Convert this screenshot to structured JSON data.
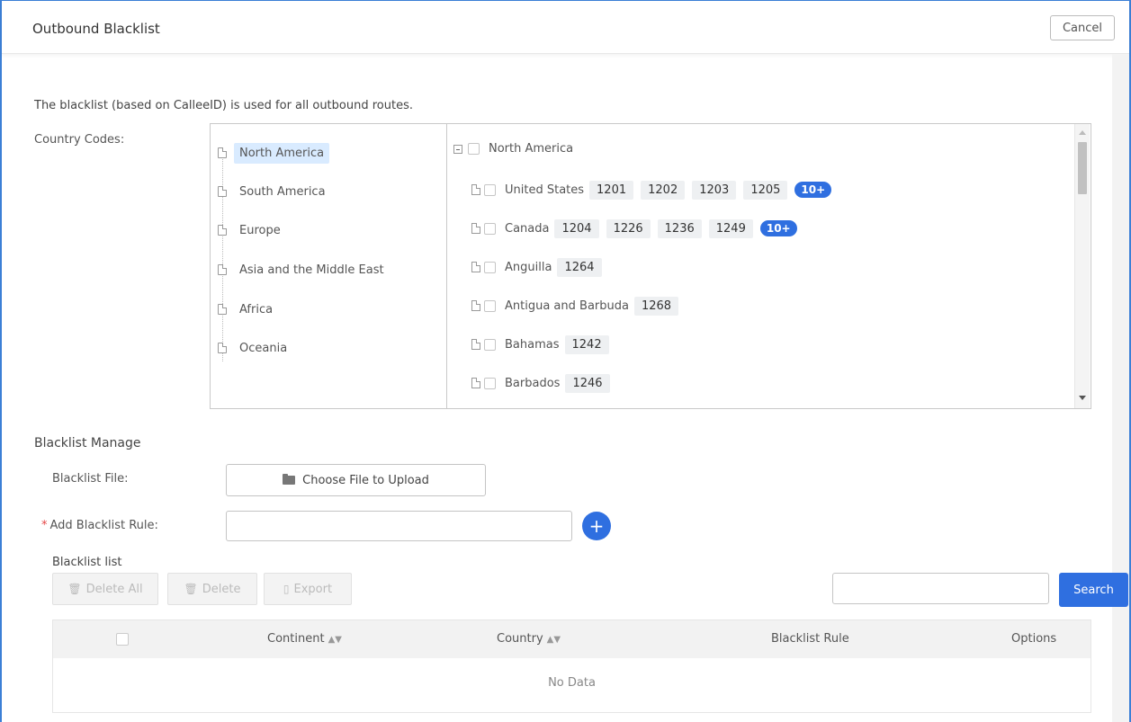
{
  "header": {
    "title": "Outbound Blacklist",
    "cancel_label": "Cancel"
  },
  "description": "The blacklist (based on CalleeID) is used for all outbound routes.",
  "country_codes": {
    "label": "Country Codes:",
    "continents": [
      {
        "name": "North America",
        "selected": true
      },
      {
        "name": "South America"
      },
      {
        "name": "Europe"
      },
      {
        "name": "Asia and the Middle East"
      },
      {
        "name": "Africa"
      },
      {
        "name": "Oceania"
      }
    ],
    "root_label": "North America",
    "countries": [
      {
        "name": "United States",
        "codes": [
          "1201",
          "1202",
          "1203",
          "1205"
        ],
        "more": "10+"
      },
      {
        "name": "Canada",
        "codes": [
          "1204",
          "1226",
          "1236",
          "1249"
        ],
        "more": "10+"
      },
      {
        "name": "Anguilla",
        "codes": [
          "1264"
        ]
      },
      {
        "name": "Antigua and Barbuda",
        "codes": [
          "1268"
        ]
      },
      {
        "name": "Bahamas",
        "codes": [
          "1242"
        ]
      },
      {
        "name": "Barbados",
        "codes": [
          "1246"
        ]
      }
    ]
  },
  "manage": {
    "title": "Blacklist Manage",
    "file_label": "Blacklist File:",
    "upload_label": "Choose File to Upload",
    "rule_label": "Add Blacklist Rule:",
    "rule_required_mark": "*",
    "rule_value": "",
    "add_label": "+"
  },
  "list": {
    "label": "Blacklist list",
    "delete_all": "Delete All",
    "delete": "Delete",
    "export": "Export",
    "search_value": "",
    "search_label": "Search",
    "columns": [
      "Continent",
      "Country",
      "Blacklist Rule",
      "Options"
    ],
    "empty_text": "No Data"
  },
  "colors": {
    "accent": "#2f6fe0",
    "frame": "#3b7fd6",
    "required": "#e54545"
  }
}
